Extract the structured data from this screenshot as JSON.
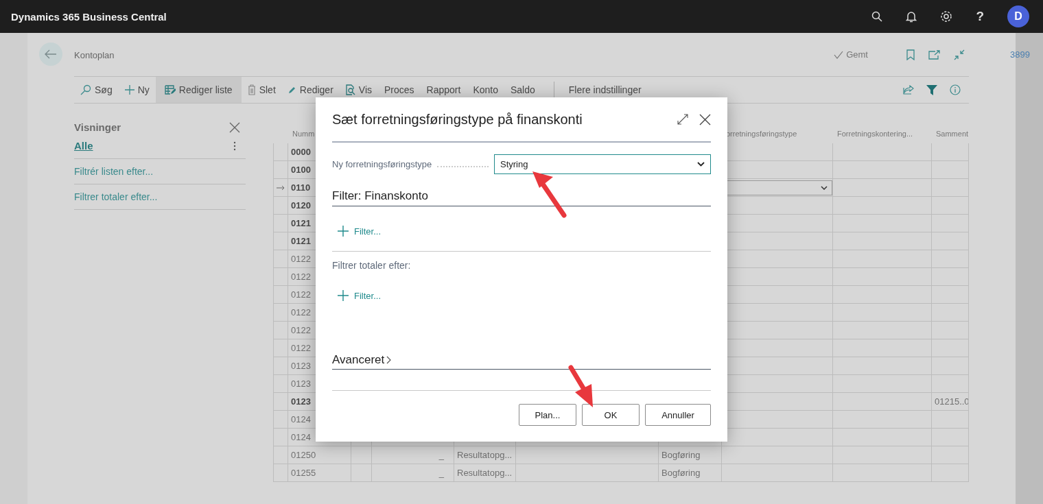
{
  "app_bar": {
    "title": "Dynamics 365 Business Central",
    "help": "?",
    "avatar": "D"
  },
  "page": {
    "title": "Kontoplan",
    "saved": "Gemt",
    "side_number": "3899"
  },
  "actions": [
    {
      "label": "Søg",
      "selected": false
    },
    {
      "label": "Ny",
      "selected": false
    },
    {
      "label": "Rediger liste",
      "selected": true
    },
    {
      "label": "Slet",
      "selected": false
    },
    {
      "label": "Rediger",
      "selected": false
    },
    {
      "label": "Vis",
      "selected": false
    },
    {
      "label": "Proces",
      "selected": false
    },
    {
      "label": "Rapport",
      "selected": false
    },
    {
      "label": "Konto",
      "selected": false
    },
    {
      "label": "Saldo",
      "selected": false
    }
  ],
  "more_options": "Flere indstillinger",
  "views_pane": {
    "title": "Visninger",
    "views": [
      {
        "label": "Alle",
        "selected": true
      }
    ],
    "links": [
      "Filtrér listen efter...",
      "Filtrer totaler efter..."
    ]
  },
  "table": {
    "columns": [
      {
        "label": "Numm"
      },
      {
        "label": "orretningsføringstype"
      },
      {
        "label": "Forretningskontering..."
      },
      {
        "label": "Samment"
      }
    ],
    "rows": [
      {
        "number": "0000",
        "kind": "heading",
        "selected": false
      },
      {
        "number": "0100",
        "kind": "heading",
        "selected": false
      },
      {
        "number": "0110",
        "kind": "heading",
        "selected": true
      },
      {
        "number": "0120",
        "kind": "heading",
        "selected": false
      },
      {
        "number": "0121",
        "kind": "heading",
        "selected": false
      },
      {
        "number": "0121",
        "kind": "heading",
        "selected": false
      },
      {
        "number": "0122",
        "kind": "posting",
        "selected": false
      },
      {
        "number": "0122",
        "kind": "posting",
        "selected": false
      },
      {
        "number": "0122",
        "kind": "posting",
        "selected": false
      },
      {
        "number": "0122",
        "kind": "posting",
        "selected": false
      },
      {
        "number": "0122",
        "kind": "posting",
        "selected": false
      },
      {
        "number": "0122",
        "kind": "posting",
        "selected": false
      },
      {
        "number": "0123",
        "kind": "posting",
        "selected": false
      },
      {
        "number": "0123",
        "kind": "posting",
        "selected": false
      },
      {
        "number": "0123",
        "kind": "heading",
        "selected": false,
        "totaling": "01215..0"
      },
      {
        "number": "0124",
        "kind": "posting",
        "selected": false
      },
      {
        "number": "0124",
        "kind": "posting",
        "selected": false
      },
      {
        "number": "01250",
        "kind": "posting",
        "selected": false,
        "indent_mark": "_",
        "category": "Resultatopg...",
        "account_type": "Bogføring"
      },
      {
        "number": "01255",
        "kind": "posting",
        "selected": false,
        "indent_mark": "_",
        "category": "Resultatopg...",
        "account_type": "Bogføring"
      }
    ]
  },
  "dialog": {
    "title": "Sæt forretningsføringstype på finanskonti",
    "field": {
      "label": "Ny forretningsføringstype",
      "value": "Styring"
    },
    "filter_heading": "Filter: Finanskonto",
    "filter_links": [
      "Filter...",
      "Filter..."
    ],
    "totals_label": "Filtrer totaler efter:",
    "advanced": {
      "label": "Avanceret",
      "expanded": false
    },
    "buttons": [
      "Plan...",
      "OK",
      "Annuller"
    ]
  }
}
